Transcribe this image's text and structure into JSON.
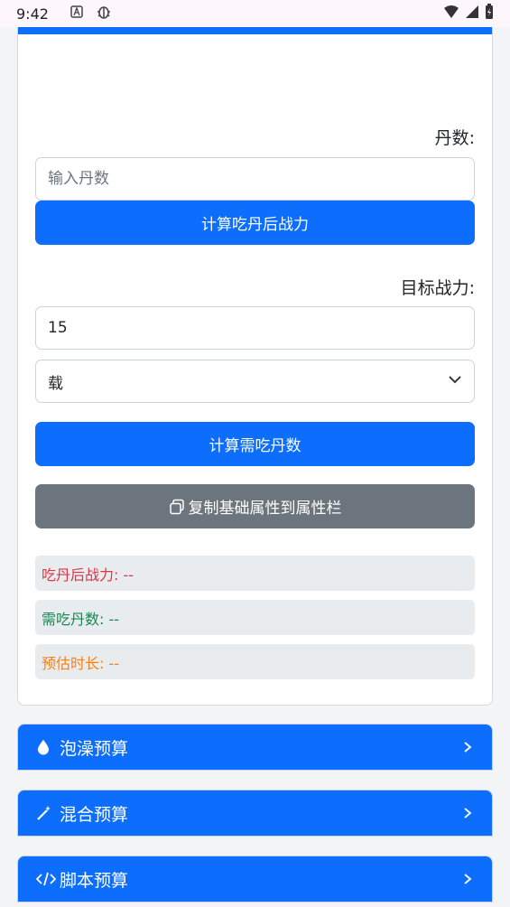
{
  "status": {
    "time": "9:42"
  },
  "form": {
    "dan_label": "丹数:",
    "dan_placeholder": "输入丹数",
    "calc_after_label": "计算吃丹后战力",
    "target_label": "目标战力:",
    "target_value": "15",
    "unit_selected": "载",
    "calc_need_label": "计算需吃丹数",
    "copy_label": "复制基础属性到属性栏"
  },
  "results": {
    "after_power": "吃丹后战力: --",
    "need_dan": "需吃丹数: --",
    "est_time": "预估时长: --"
  },
  "sections": [
    {
      "label": "泡澡预算",
      "icon": "droplet-icon"
    },
    {
      "label": "混合预算",
      "icon": "magic-wand-icon"
    },
    {
      "label": "脚本预算",
      "icon": "code-icon"
    }
  ],
  "colors": {
    "primary": "#0d6efd",
    "secondary": "#6c757d",
    "red": "#dc3545",
    "green": "#198754",
    "orange": "#fd7e14"
  }
}
